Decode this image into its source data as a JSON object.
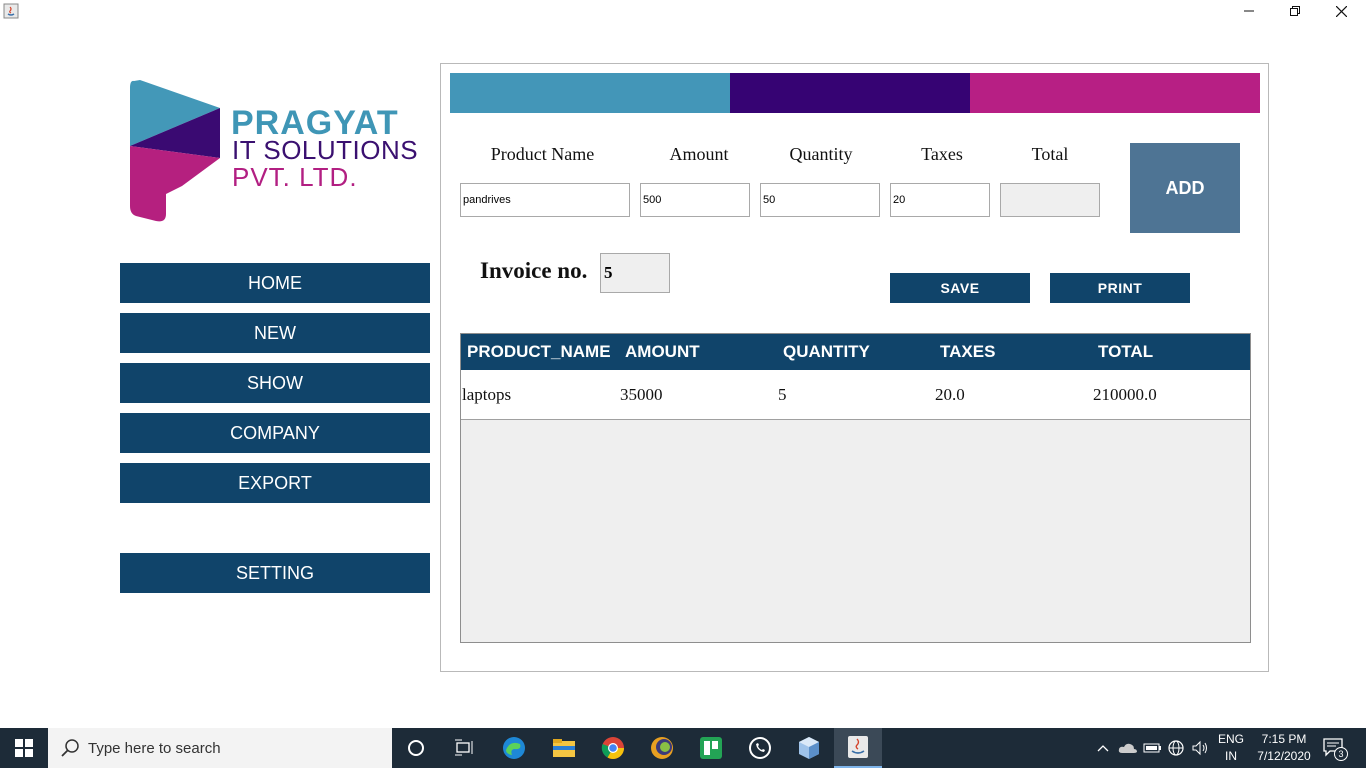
{
  "window": {
    "minimize": "—",
    "restore": "❐",
    "close": "✕"
  },
  "logo": {
    "line1": "PRAGYAT",
    "line2": "IT SOLUTIONS",
    "line3": "PVT. LTD."
  },
  "sidebar": {
    "items": [
      {
        "label": "HOME"
      },
      {
        "label": "NEW"
      },
      {
        "label": "SHOW"
      },
      {
        "label": "COMPANY"
      },
      {
        "label": "EXPORT"
      },
      {
        "label": "SETTING"
      }
    ]
  },
  "colors": {
    "stripe_blue": "#4396b8",
    "stripe_purple": "#360373",
    "stripe_magenta": "#b71f84",
    "nav": "#10446a",
    "add": "#4e7494"
  },
  "form": {
    "labels": {
      "product": "Product Name",
      "amount": "Amount",
      "quantity": "Quantity",
      "taxes": "Taxes",
      "total": "Total"
    },
    "values": {
      "product": "pandrives",
      "amount": "500",
      "quantity": "50",
      "taxes": "20",
      "total": ""
    },
    "add_label": "ADD",
    "invoice_label": "Invoice no.",
    "invoice_value": "5",
    "save_label": "SAVE",
    "print_label": "PRINT"
  },
  "table": {
    "columns": [
      "PRODUCT_NAME",
      "AMOUNT",
      "QUANTITY",
      "TAXES",
      "TOTAL"
    ],
    "rows": [
      [
        "laptops",
        "35000",
        "5",
        "20.0",
        "210000.0"
      ]
    ]
  },
  "taskbar": {
    "search_placeholder": "Type here to search",
    "apps": [
      "cortana-icon",
      "task-view-icon",
      "edge-icon",
      "file-explorer-icon",
      "chrome-icon",
      "eclipse-icon",
      "trello-icon",
      "whatsapp-icon",
      "virtualbox-icon",
      "java-icon"
    ],
    "lang_line1": "ENG",
    "lang_line2": "IN",
    "time": "7:15 PM",
    "date": "7/12/2020",
    "notification_count": "3"
  }
}
